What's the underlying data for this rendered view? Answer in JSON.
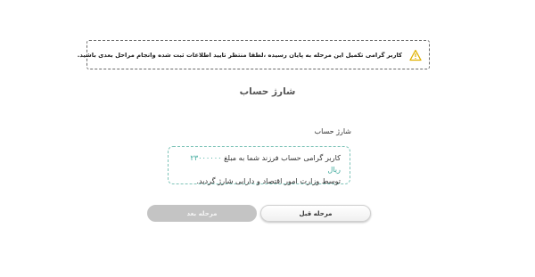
{
  "alert": {
    "icon": "warning-icon",
    "message": "کاربر گرامی تکمیل این مرحله به پایان رسیده ،لطفا منتظر تایید اطلاعات ثبت شده وانجام مراحل بعدی باشید."
  },
  "step": {
    "title": "شارژ حساب"
  },
  "section": {
    "label": "شارژ حساب"
  },
  "info": {
    "prefix": "کاربر گرامی حساب فرزند شما به مبلغ",
    "amount": "۲۳۰۰۰۰۰۰ ریال",
    "suffix": "توسط وزارت امور اقتصاد و دارایی شارژ گردید."
  },
  "buttons": {
    "prev_label": "مرحله قبل",
    "next_label": "مرحله بعد"
  },
  "colors": {
    "accent": "#3aa89a",
    "warning": "#e0b100",
    "disabled_button": "#c4c4c4"
  }
}
